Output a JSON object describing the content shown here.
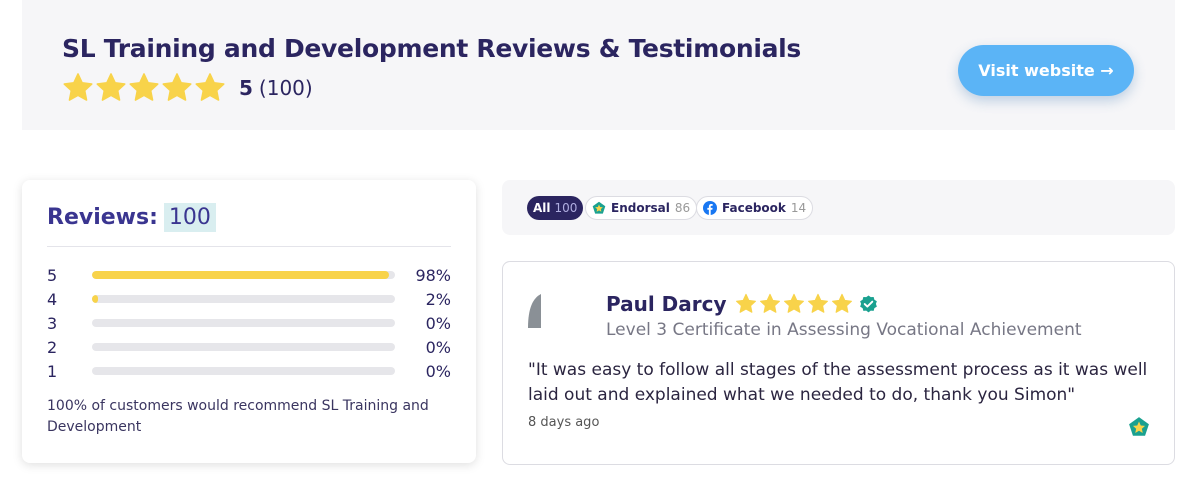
{
  "header": {
    "title": "SL Training and Development Reviews & Testimonials",
    "rating": "5",
    "rating_count": "(100)",
    "star_count": 5,
    "visit_button": "Visit website →"
  },
  "summary": {
    "label": "Reviews:",
    "count": "100",
    "bars": [
      {
        "stars": "5",
        "percent": 98,
        "percent_label": "98%"
      },
      {
        "stars": "4",
        "percent": 2,
        "percent_label": "2%"
      },
      {
        "stars": "3",
        "percent": 0,
        "percent_label": "0%"
      },
      {
        "stars": "2",
        "percent": 0,
        "percent_label": "0%"
      },
      {
        "stars": "1",
        "percent": 0,
        "percent_label": "0%"
      }
    ],
    "recommend_text": "100% of customers would recommend SL Training and Development"
  },
  "filters": [
    {
      "label": "All",
      "count": "100",
      "icon": null
    },
    {
      "label": "Endorsal",
      "count": "86",
      "icon": "endorsal-icon"
    },
    {
      "label": "Facebook",
      "count": "14",
      "icon": "facebook-icon"
    }
  ],
  "review": {
    "name": "Paul Darcy",
    "stars": 5,
    "verified_icon": "verified-badge-icon",
    "course": "Level 3 Certificate in Assessing Vocational Achievement",
    "quote": "\"It was easy to follow all stages of the assessment process as it was well laid out and explained what we needed to do, thank you Simon\"",
    "date": "8 days ago",
    "source_icon": "endorsal-icon"
  },
  "colors": {
    "star": "#f8d34a",
    "accent_blue": "#5bb4f6",
    "navy": "#2b2560",
    "verified": "#1aa190",
    "facebook": "#1877f2"
  }
}
